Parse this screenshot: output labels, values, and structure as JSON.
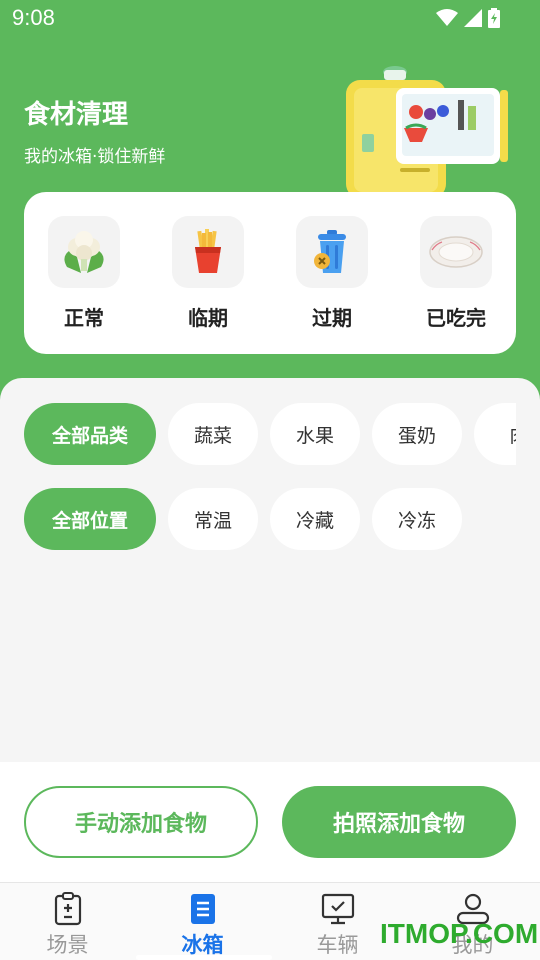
{
  "status_bar": {
    "time": "9:08"
  },
  "header": {
    "title": "食材清理",
    "subtitle": "我的冰箱·锁住新鲜"
  },
  "status_items": [
    {
      "label": "正常",
      "icon": "cauliflower-icon"
    },
    {
      "label": "临期",
      "icon": "fries-icon"
    },
    {
      "label": "过期",
      "icon": "trash-can-icon"
    },
    {
      "label": "已吃完",
      "icon": "empty-plate-icon"
    }
  ],
  "category_filters": [
    "全部品类",
    "蔬菜",
    "水果",
    "蛋奶",
    "肉"
  ],
  "location_filters": [
    "全部位置",
    "常温",
    "冷藏",
    "冷冻"
  ],
  "actions": {
    "manual_add": "手动添加食物",
    "photo_add": "拍照添加食物"
  },
  "tabs": [
    {
      "label": "场景",
      "icon": "clipboard-icon"
    },
    {
      "label": "冰箱",
      "icon": "document-icon"
    },
    {
      "label": "车辆",
      "icon": "monitor-icon"
    },
    {
      "label": "我的",
      "icon": "person-icon"
    }
  ],
  "watermark": "ITMOP.COM",
  "colors": {
    "primary": "#5cb85c",
    "tab_active": "#1a73e8",
    "tab_inactive": "#999999"
  }
}
